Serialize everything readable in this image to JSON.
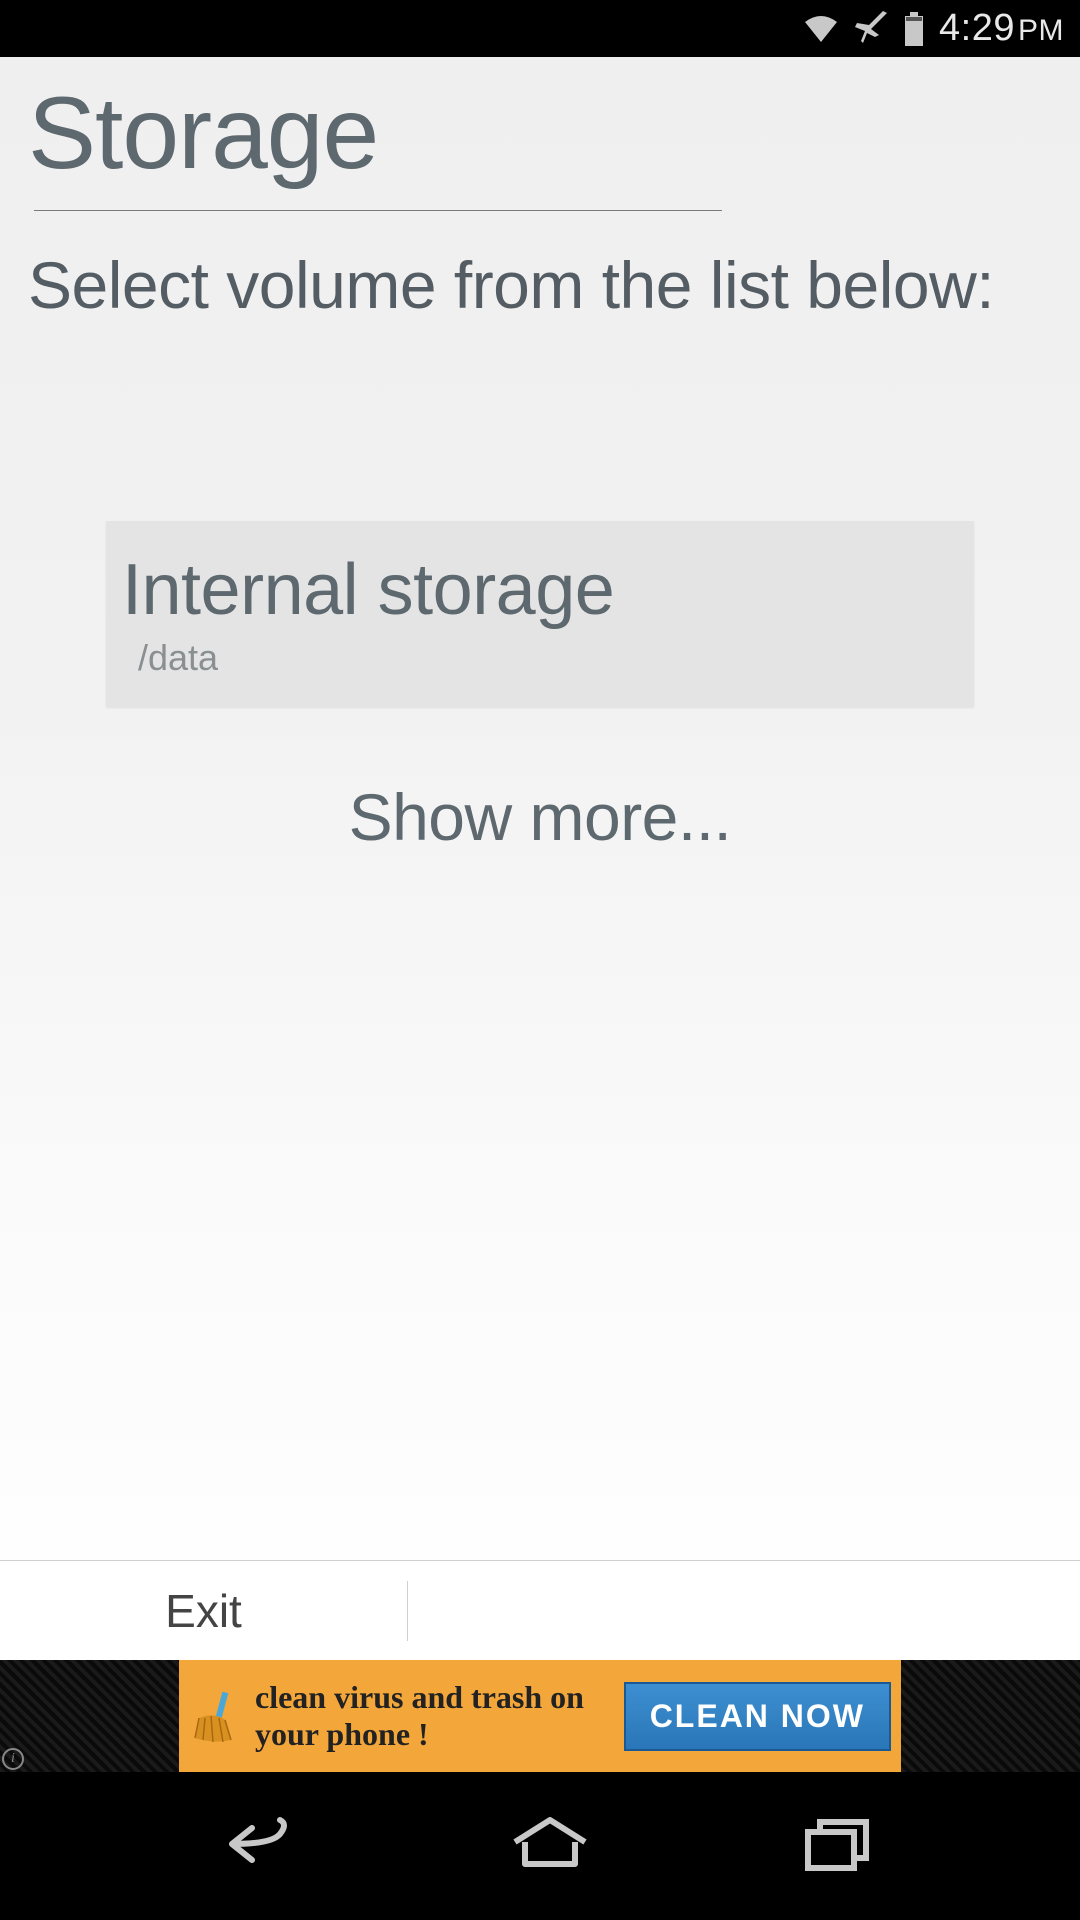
{
  "status": {
    "time": "4:29",
    "time_suffix": "PM"
  },
  "page": {
    "title": "Storage",
    "instruction": "Select volume from the list below:"
  },
  "volumes": [
    {
      "name": "Internal storage",
      "path": "/data"
    }
  ],
  "show_more": "Show more...",
  "actions": {
    "exit": "Exit"
  },
  "ad": {
    "text": "clean virus and trash on your phone !",
    "button": "CLEAN  NOW"
  }
}
